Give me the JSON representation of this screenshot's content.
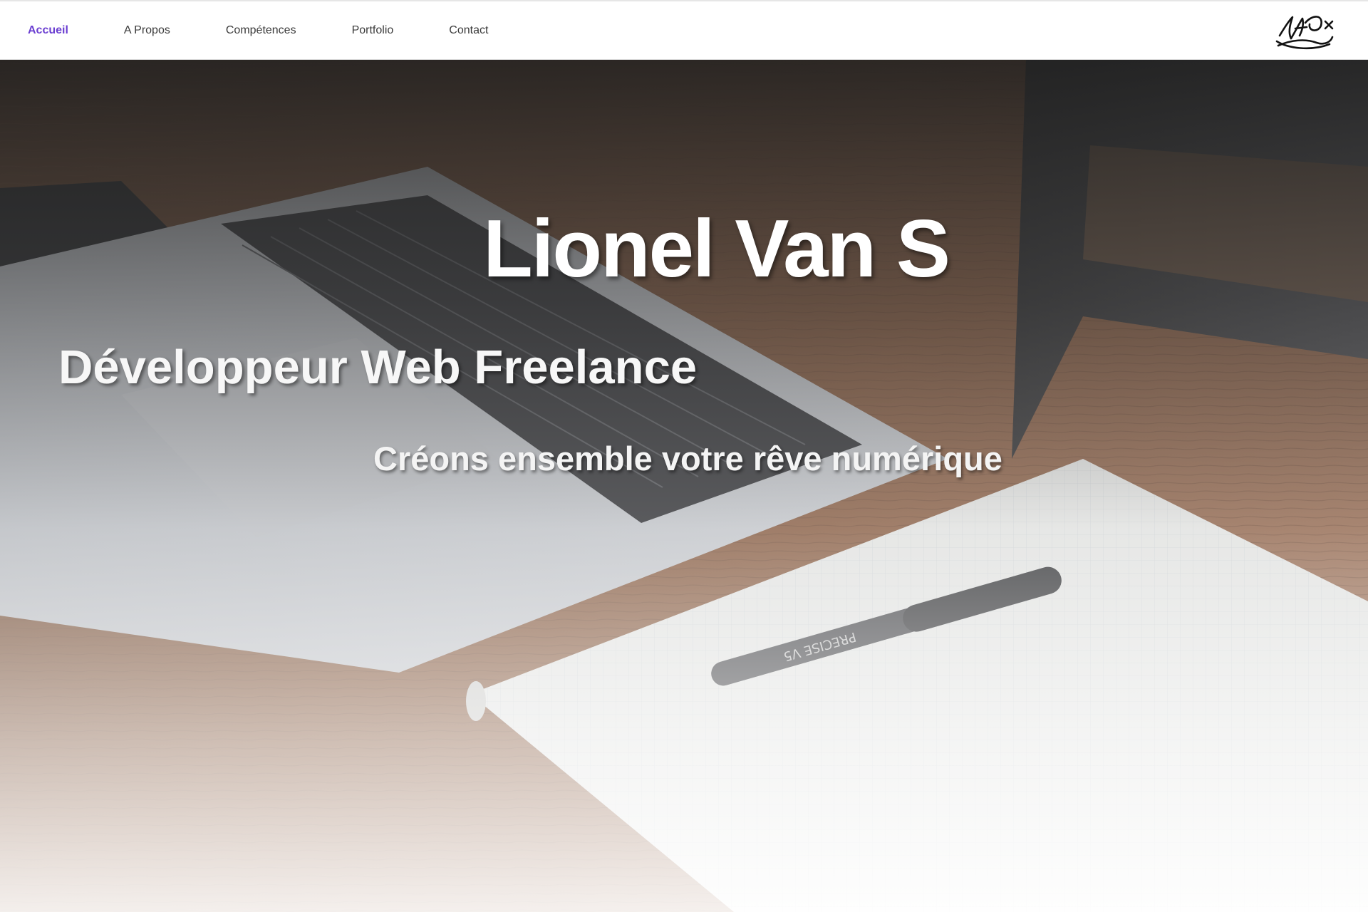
{
  "nav": {
    "items": [
      {
        "label": "Accueil",
        "active": true
      },
      {
        "label": "A Propos",
        "active": false
      },
      {
        "label": "Compétences",
        "active": false
      },
      {
        "label": "Portfolio",
        "active": false
      },
      {
        "label": "Contact",
        "active": false
      }
    ],
    "logo_icon": "signature-logo-icon",
    "active_color": "#6b3fd1"
  },
  "hero": {
    "title": "Lionel Van S",
    "subtitle": "Développeur Web Freelance",
    "tagline": "Créons ensemble votre rêve numérique",
    "background_icon": "laptop-notebook-pen-photo"
  }
}
